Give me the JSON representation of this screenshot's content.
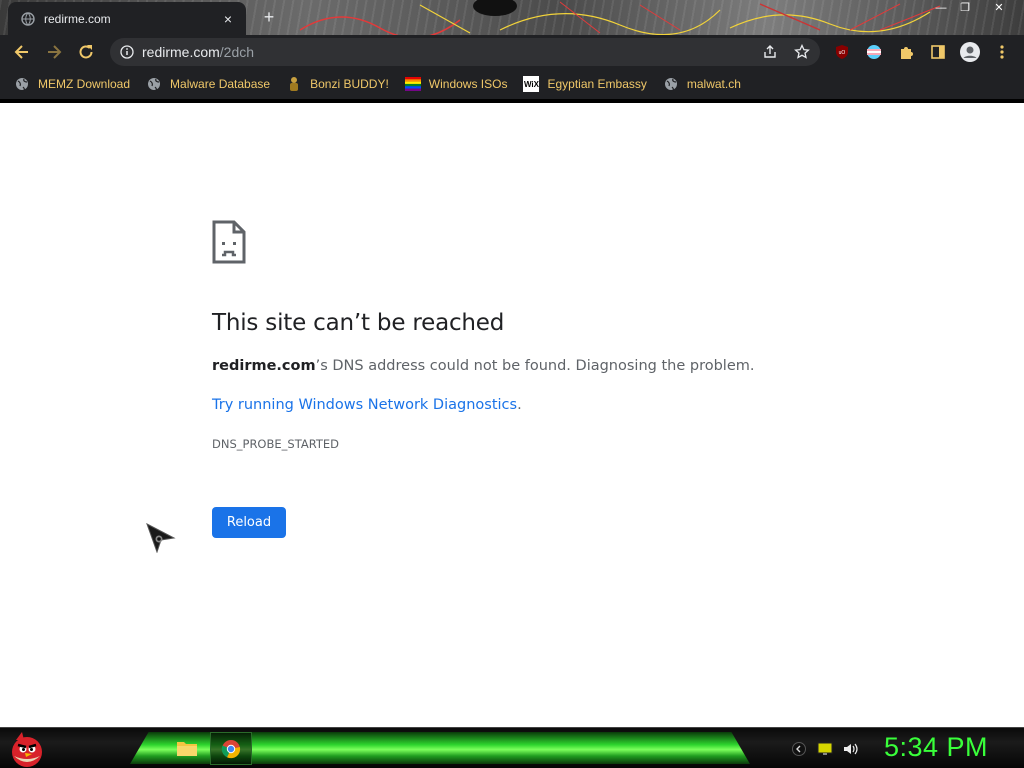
{
  "browser": {
    "tab": {
      "title": "redirme.com",
      "close_glyph": "×"
    },
    "new_tab_glyph": "+",
    "window_controls": {
      "minimize": "—",
      "restore": "❐",
      "close": "✕"
    },
    "address": {
      "host": "redirme.com",
      "path": "/2dch"
    },
    "toolbar_icons": [
      "back-arrow-icon",
      "forward-arrow-icon",
      "reload-icon",
      "info-icon",
      "share-icon",
      "star-icon",
      "ublock-icon",
      "extension-flag-icon",
      "puzzle-icon",
      "sidepanel-icon",
      "profile-icon",
      "menu-dots-icon"
    ]
  },
  "bookmarks": [
    {
      "label": "MEMZ Download",
      "icon": "globe-icon"
    },
    {
      "label": "Malware Database",
      "icon": "globe-icon"
    },
    {
      "label": "Bonzi BUDDY!",
      "icon": "bonzi-icon"
    },
    {
      "label": "Windows ISOs",
      "icon": "rainbow-icon"
    },
    {
      "label": "Egyptian Embassy",
      "icon": "wix-icon",
      "icon_text": "WiX"
    },
    {
      "label": "malwat.ch",
      "icon": "globe-icon"
    }
  ],
  "error_page": {
    "title": "This site can’t be reached",
    "host": "redirme.com",
    "description_suffix": "’s DNS address could not be found. Diagnosing the problem.",
    "link": "Try running Windows Network Diagnostics",
    "link_suffix": ".",
    "code": "DNS_PROBE_STARTED",
    "reload_label": "Reload"
  },
  "taskbar": {
    "clock": "5:34 PM",
    "pinned": [
      "folder-icon",
      "chrome-icon"
    ],
    "tray": [
      "chevron-icon",
      "network-icon",
      "volume-icon"
    ]
  },
  "colors": {
    "bookmark_text": "#f0c869",
    "link": "#1a73e8",
    "reload_button": "#1a73e8",
    "clock": "#39ff3a",
    "chrome_dark": "#202124"
  }
}
